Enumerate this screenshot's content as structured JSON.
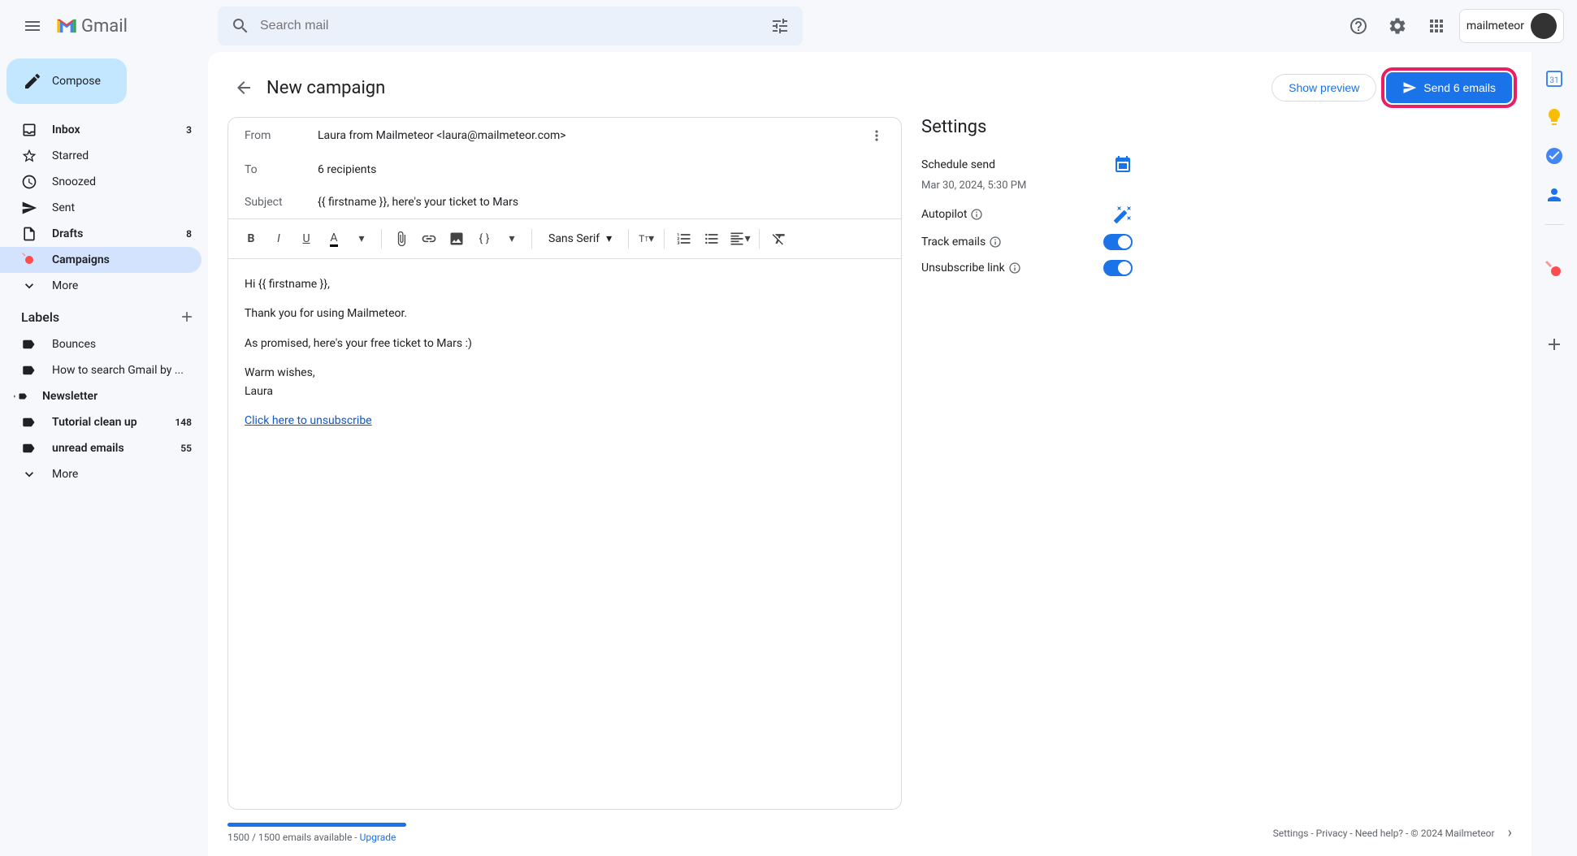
{
  "header": {
    "logo_text": "Gmail",
    "search_placeholder": "Search mail",
    "account_name": "mailmeteor"
  },
  "sidebar": {
    "compose": "Compose",
    "nav": [
      {
        "label": "Inbox",
        "count": "3",
        "bold": true
      },
      {
        "label": "Starred",
        "count": "",
        "bold": false
      },
      {
        "label": "Snoozed",
        "count": "",
        "bold": false
      },
      {
        "label": "Sent",
        "count": "",
        "bold": false
      },
      {
        "label": "Drafts",
        "count": "8",
        "bold": true
      },
      {
        "label": "Campaigns",
        "count": "",
        "bold": true
      },
      {
        "label": "More",
        "count": "",
        "bold": false
      }
    ],
    "labels_title": "Labels",
    "labels": [
      {
        "label": "Bounces",
        "count": "",
        "bold": false
      },
      {
        "label": "How to search Gmail by ...",
        "count": "",
        "bold": false
      },
      {
        "label": "Newsletter",
        "count": "",
        "bold": true
      },
      {
        "label": "Tutorial clean up",
        "count": "148",
        "bold": true
      },
      {
        "label": "unread emails",
        "count": "55",
        "bold": true
      },
      {
        "label": "More",
        "count": "",
        "bold": false
      }
    ]
  },
  "page": {
    "title": "New campaign",
    "preview_btn": "Show preview",
    "send_btn": "Send 6 emails"
  },
  "compose": {
    "from_label": "From",
    "from_value": "Laura from Mailmeteor <laura@mailmeteor.com>",
    "to_label": "To",
    "to_value": "6 recipients",
    "subject_label": "Subject",
    "subject_value": "{{ firstname }}, here's your ticket to Mars",
    "font": "Sans Serif",
    "body": {
      "greeting": "Hi {{ firstname }},",
      "line1": "Thank you for using Mailmeteor.",
      "line2": "As promised, here's your free ticket to Mars :)",
      "closing1": "Warm wishes,",
      "closing2": "Laura",
      "unsubscribe": "Click here to unsubscribe"
    }
  },
  "settings": {
    "title": "Settings",
    "schedule_label": "Schedule send",
    "schedule_time": "Mar 30, 2024, 5:30 PM",
    "autopilot_label": "Autopilot",
    "track_label": "Track emails",
    "unsubscribe_label": "Unsubscribe link"
  },
  "footer": {
    "quota": "1500 / 1500 emails available - ",
    "upgrade": "Upgrade",
    "links": "Settings - Privacy - Need help? - © 2024 Mailmeteor"
  }
}
